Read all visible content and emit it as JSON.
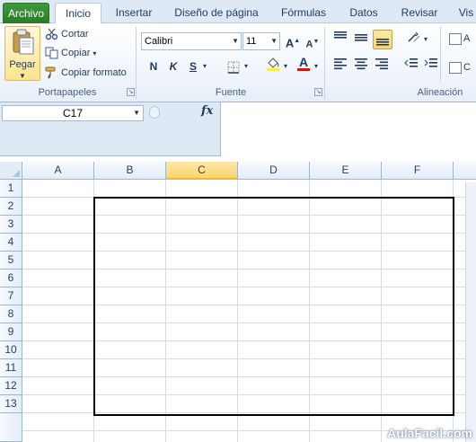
{
  "tabs": [
    {
      "label": "Archivo",
      "kind": "file"
    },
    {
      "label": "Inicio",
      "kind": "active"
    },
    {
      "label": "Insertar"
    },
    {
      "label": "Diseño de página"
    },
    {
      "label": "Fórmulas"
    },
    {
      "label": "Datos"
    },
    {
      "label": "Revisar"
    },
    {
      "label": "Vis"
    }
  ],
  "clipboard": {
    "paste_label": "Pegar",
    "cut_label": "Cortar",
    "copy_label": "Copiar",
    "format_painter_label": "Copiar formato",
    "group_label": "Portapapeles"
  },
  "font": {
    "font_name": "Calibri",
    "font_size": "11",
    "bold": "N",
    "italic": "K",
    "underline": "S",
    "group_label": "Fuente"
  },
  "alignment": {
    "group_label": "Alineación",
    "wrap_short": "A",
    "merge_short": "C"
  },
  "formula_bar": {
    "name_box": "C17",
    "fx_label": "fx",
    "formula": ""
  },
  "grid": {
    "columns": [
      "A",
      "B",
      "C",
      "D",
      "E",
      "F"
    ],
    "selected_column": "C",
    "rows": [
      "1",
      "2",
      "3",
      "4",
      "5",
      "6",
      "7",
      "8",
      "9",
      "10",
      "11",
      "12",
      "13"
    ],
    "bordered_range": "B2:F13"
  },
  "watermark": "AulaFacil.com",
  "colors": {
    "file_tab": "#2a7d27",
    "selected_header": "#f9d472",
    "gridline": "#d4dce8",
    "border_black": "#000000"
  }
}
